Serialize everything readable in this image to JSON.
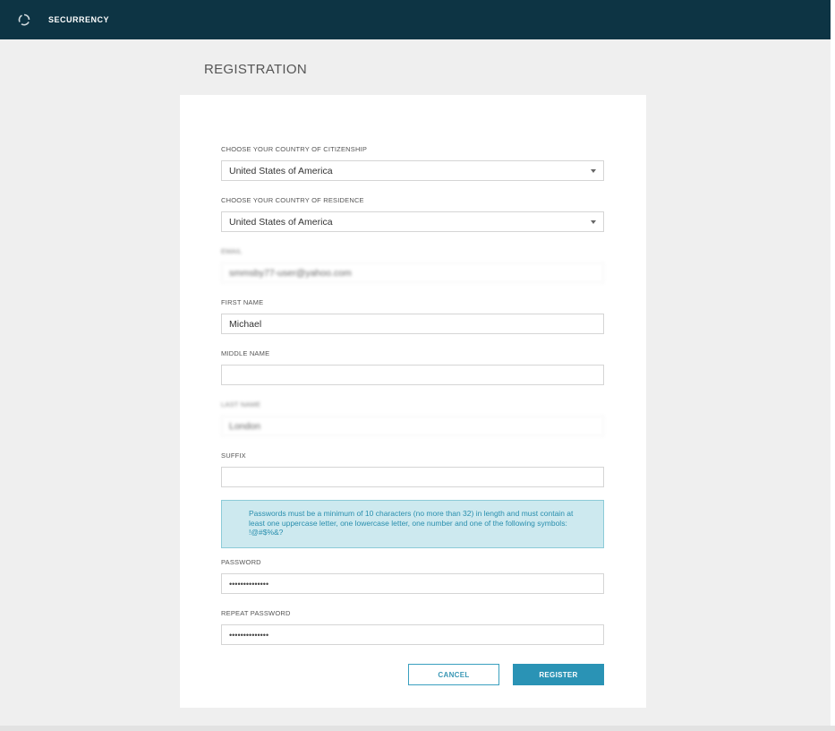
{
  "header": {
    "brand": "SECURRENCY",
    "logo_icon": "logo-icon",
    "background_color": "#0d3444"
  },
  "page": {
    "title": "REGISTRATION"
  },
  "form": {
    "citizenship": {
      "label": "CHOOSE YOUR COUNTRY OF CITIZENSHIP",
      "value": "United States of America"
    },
    "residence": {
      "label": "CHOOSE YOUR COUNTRY OF RESIDENCE",
      "value": "United States of America"
    },
    "email": {
      "label": "EMAIL",
      "value": "smmsby77-user@yahoo.com"
    },
    "first_name": {
      "label": "FIRST NAME",
      "value": "Michael"
    },
    "middle_name": {
      "label": "MIDDLE NAME",
      "value": ""
    },
    "last_name": {
      "label": "LAST NAME",
      "value": "London"
    },
    "suffix": {
      "label": "SUFFIX",
      "value": ""
    },
    "password_notice": "Passwords must be a minimum of 10 characters (no more than 32) in length and must contain at least one uppercase letter, one lowercase letter, one number and one of the following symbols: !@#$%&?",
    "password": {
      "label": "PASSWORD",
      "value": "••••••••••••••"
    },
    "repeat_password": {
      "label": "REPEAT PASSWORD",
      "value": "••••••••••••••"
    }
  },
  "actions": {
    "cancel_label": "CANCEL",
    "register_label": "REGISTER",
    "accent_color": "#2a93b5"
  }
}
